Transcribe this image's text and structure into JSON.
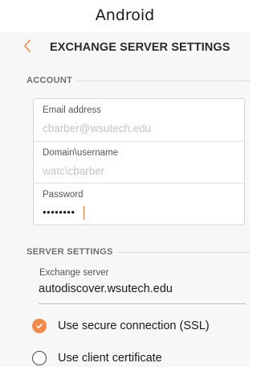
{
  "caption": "Android",
  "appbar": {
    "title": "EXCHANGE SERVER SETTINGS",
    "back_icon": "chevron-left-icon",
    "accent_color": "#f08a4b"
  },
  "account": {
    "header": "ACCOUNT",
    "fields": [
      {
        "label": "Email address",
        "value": "cbarber@wsutech.edu"
      },
      {
        "label": "Domain\\username",
        "value": "watc\\cbarber"
      },
      {
        "label": "Password",
        "value": "••••••••"
      }
    ]
  },
  "server_settings": {
    "header": "SERVER SETTINGS",
    "exchange_server_label": "Exchange server",
    "exchange_server_value": "autodiscover.wsutech.edu",
    "options": [
      {
        "label": "Use secure connection (SSL)",
        "selected": true
      },
      {
        "label": "Use client certificate",
        "selected": false
      }
    ]
  }
}
